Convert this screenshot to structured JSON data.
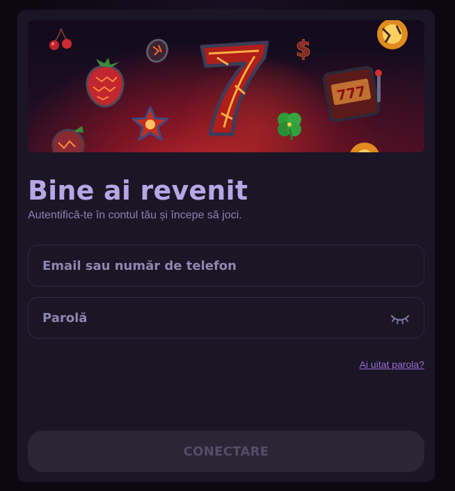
{
  "login": {
    "title": "Bine ai revenit",
    "subtitle": "Autentifică-te în contul tău și începe să joci.",
    "email_placeholder": "Email sau număr de telefon",
    "password_placeholder": "Parolă",
    "forgot_link": "Ai uitat parola?",
    "submit_label": "CONECTARE"
  },
  "banner": {
    "slot_reels": "777",
    "icons": [
      "cherry-icon",
      "strawberry-icon",
      "plum-icon",
      "seven-icon",
      "star-icon",
      "clover-icon",
      "dollar-icon",
      "slot-machine-icon",
      "fire-ball-icon"
    ]
  },
  "colors": {
    "title": "#b7a6e6",
    "link": "#a16ad6",
    "button_bg": "#2a2636",
    "modal_bg": "#1a1626"
  }
}
